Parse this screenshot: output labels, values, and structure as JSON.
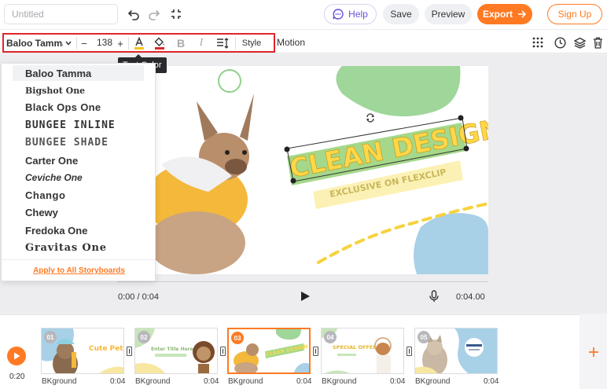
{
  "header": {
    "title_placeholder": "Untitled",
    "help_label": "Help",
    "save_label": "Save",
    "preview_label": "Preview",
    "export_label": "Export",
    "signup_label": "Sign Up"
  },
  "toolbar": {
    "font_name": "Baloo Tamma",
    "font_size": "138",
    "minus": "−",
    "plus": "+",
    "style_label": "Style",
    "motion_label": "Motion",
    "tooltip": "Text Color",
    "colors": {
      "text_color_underline": "#f5c518",
      "fill_underline": "#e0262c",
      "highlight_box": "#e0262c"
    }
  },
  "font_list": {
    "items": [
      "Baloo Tamma",
      "Bigshot One",
      "Black Ops One",
      "BUNGEE INLINE",
      "BUNGEE SHADE",
      "Carter One",
      "Ceviche One",
      "Chango",
      "Chewy",
      "Fredoka One",
      "Gravitas One"
    ],
    "apply_all": "Apply to All Storyboards"
  },
  "canvas": {
    "headline": "CLEAN DESIGN",
    "subline": "EXCLUSIVE ON FLEXCLIP"
  },
  "player": {
    "current_time": "0:00 / 0:04",
    "total_time": "0:04.00"
  },
  "storyboard": {
    "total_time": "0:20",
    "scenes": [
      {
        "num": "01",
        "label": "BKground",
        "duration": "0:04",
        "text": "Cute Pet"
      },
      {
        "num": "02",
        "label": "BKground",
        "duration": "0:04",
        "text": "Enter Title Here"
      },
      {
        "num": "03",
        "label": "BKground",
        "duration": "0:04",
        "text": "CLEAN DESIGN"
      },
      {
        "num": "04",
        "label": "BKground",
        "duration": "0:04",
        "text": "SPECIAL OFFER"
      },
      {
        "num": "05",
        "label": "BKground",
        "duration": "0:04",
        "text": ""
      }
    ]
  },
  "brand": {
    "accent": "#ff7a22",
    "purple": "#6a4fd8"
  }
}
